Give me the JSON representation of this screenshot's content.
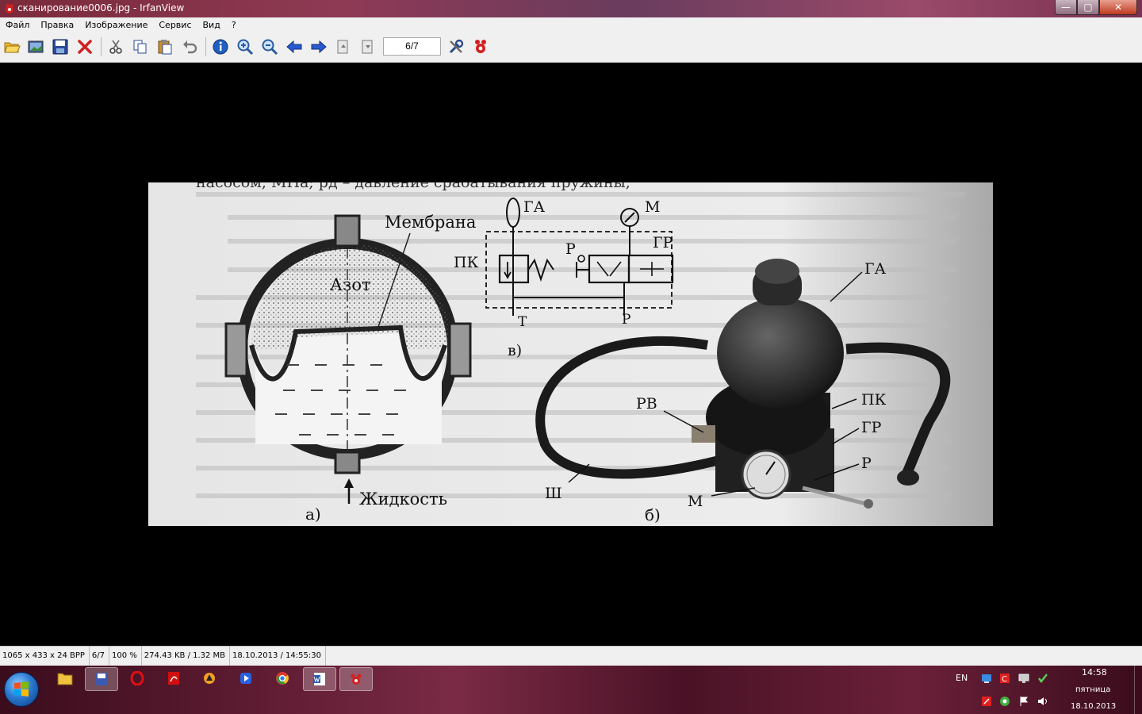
{
  "window": {
    "title": "сканирование0006.jpg - IrfanView",
    "buttons": {
      "minimize": "—",
      "maximize": "▢",
      "close": "✕"
    }
  },
  "menu": [
    "Файл",
    "Правка",
    "Изображение",
    "Сервис",
    "Вид",
    "?"
  ],
  "toolbar": {
    "page_indicator": "6/7",
    "buttons": [
      "open-folder",
      "thumbnails",
      "save",
      "delete",
      "cut",
      "copy",
      "paste",
      "undo",
      "info",
      "zoom-in",
      "zoom-out",
      "previous",
      "next",
      "first-page",
      "last-page",
      "settings",
      "irfanview"
    ]
  },
  "image_text": {
    "top_line": "насосом, МПа; pд – давление срабатывания пружины,",
    "label_membrane": "Мембрана",
    "label_nitrogen": "Азот",
    "label_liquid": "Жидкость",
    "caption_a": "а)",
    "caption_b": "б)",
    "caption_v": "в)",
    "schema_GA": "ГА",
    "schema_M": "М",
    "schema_PK": "ПК",
    "schema_P1": "Р",
    "schema_GR": "ГР",
    "schema_T": "Т",
    "schema_P2": "Р",
    "photo_GA": "ГА",
    "photo_RV": "РВ",
    "photo_PK": "ПК",
    "photo_GR": "ГР",
    "photo_P": "Р",
    "photo_Sh": "Ш",
    "photo_M": "М"
  },
  "status": [
    "1065 x 433 x 24 BPP",
    "6/7",
    "100 %",
    "274.43 KB / 1.32 MB",
    "18.10.2013 / 14:55:30"
  ],
  "taskbar": {
    "language": "EN",
    "time": "14:58",
    "weekday": "пятница",
    "date": "18.10.2013"
  }
}
